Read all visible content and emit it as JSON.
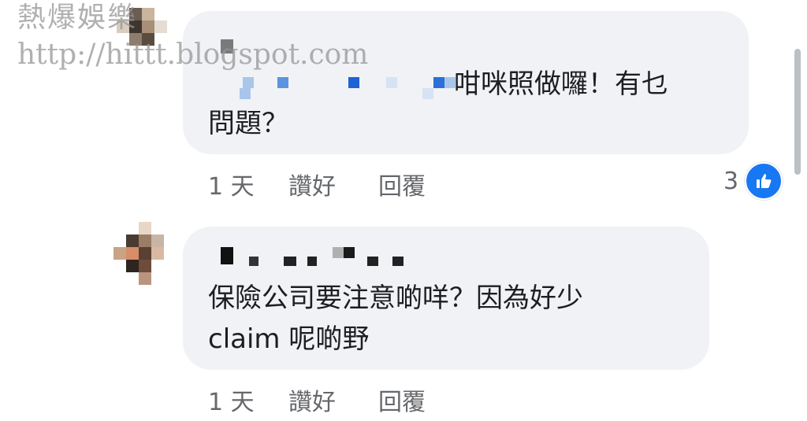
{
  "watermark": {
    "line1": "熱爆娛樂",
    "line2": "http://hittt.blogspot.com"
  },
  "comments": [
    {
      "text_line1": "咁咪照做囉！有乜",
      "text_line2": "問題？",
      "time": "1 天",
      "like_label": "讚好",
      "reply_label": "回覆",
      "reaction_count": "3"
    },
    {
      "text_line1": "保險公司要注意啲咩？因為好少",
      "text_line2": "claim 呢啲野",
      "time": "1 天",
      "like_label": "讚好",
      "reply_label": "回覆"
    }
  ],
  "icons": {
    "like": "thumbs-up-icon",
    "avatar": "pixelated-avatar"
  },
  "colors": {
    "bubble": "#f0f2f5",
    "like_blue": "#1877f2",
    "meta_text": "#65676b"
  }
}
